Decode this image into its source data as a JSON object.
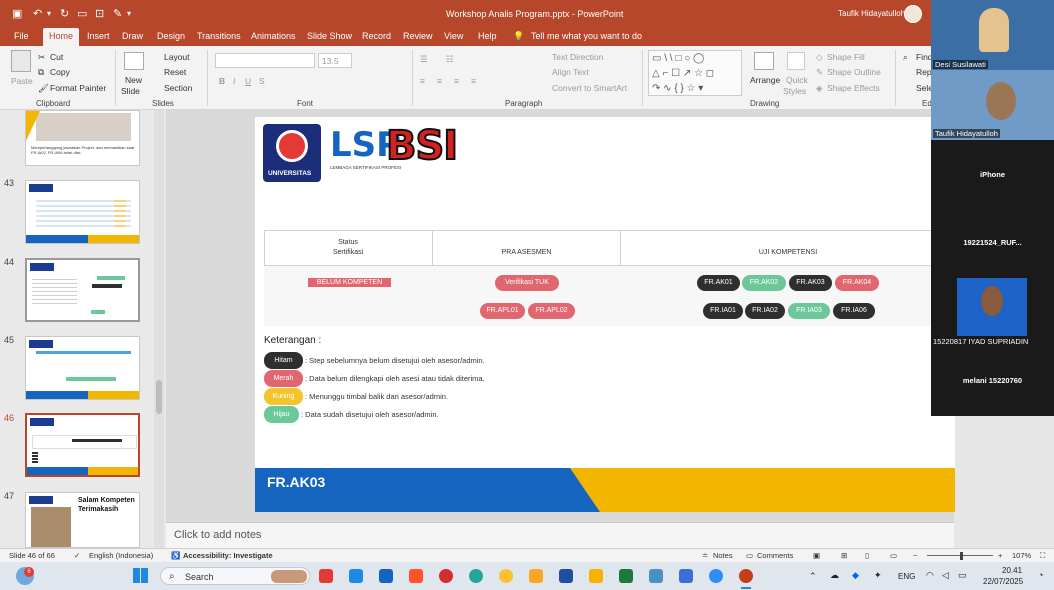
{
  "window": {
    "title": "Workshop Analis Program.pptx  -  PowerPoint",
    "user": "Taufik Hidayatulloh"
  },
  "menu": [
    "File",
    "Home",
    "Insert",
    "Draw",
    "Design",
    "Transitions",
    "Animations",
    "Slide Show",
    "Record",
    "Review",
    "View",
    "Help"
  ],
  "tell_me": "Tell me what you want to do",
  "ribbon": {
    "clipboard": {
      "paste": "Paste",
      "cut": "Cut",
      "copy": "Copy",
      "format_painter": "Format Painter",
      "group": "Clipboard"
    },
    "slides": {
      "new_slide": "New",
      "new_slide2": "Slide",
      "layout": "Layout",
      "reset": "Reset",
      "section": "Section",
      "group": "Slides"
    },
    "font": {
      "size": "13.5",
      "group": "Font"
    },
    "paragraph": {
      "text_direction": "Text Direction",
      "align_text": "Align Text",
      "smartart": "Convert to SmartArt",
      "group": "Paragraph"
    },
    "drawing": {
      "arrange": "Arrange",
      "quick": "Quick",
      "styles": "Styles",
      "shape_fill": "Shape Fill",
      "shape_outline": "Shape Outline",
      "shape_effects": "Shape Effects",
      "group": "Drawing"
    },
    "editing": {
      "find": "Find",
      "replace": "Rep",
      "select": "Sele",
      "group": "Ed"
    }
  },
  "thumbnails": {
    "numbers": [
      "43",
      "44",
      "45",
      "46",
      "47"
    ],
    "top_text": "Mempertanggung jawabkan Project, dan memastikan saat FR.IA02, FR.IA06 telah diisi.",
    "slide47_title": "Salam Kompeten",
    "slide47_sub": "Terimakasih"
  },
  "slide": {
    "logo": {
      "seal_text": "UNIVERSITAS",
      "lsp": "LSP",
      "bsi": "BSI",
      "sub": "LEMBAGA SERTIFIKASI PROFESI"
    },
    "table": {
      "col1a": "Status",
      "col1b": "Sertifikasi",
      "col2": "PRA ASESMEN",
      "col3": "UJI KOMPETENSI"
    },
    "status": "BELUM KOMPETEN",
    "pra": [
      "Verifikasi TUK",
      "FR.APL01",
      "FR.APL02"
    ],
    "uji_row1": [
      "FR.AK01",
      "FR.AK02",
      "FR.AK03",
      "FR.AK04"
    ],
    "uji_row2": [
      "FR.IA01",
      "FR.IA02",
      "FR.IA03",
      "FR.IA06"
    ],
    "keterangan": "Keterangan :",
    "legend": [
      {
        "label": "Hitam",
        "desc": ": Step sebelumnya belum disetujui oleh asesor/admin."
      },
      {
        "label": "Merah",
        "desc": ": Data belum dilengkapi oleh asesi atau tidak diterima."
      },
      {
        "label": "Kuning",
        "desc": ": Menunggu timbal balik dari asesor/admin."
      },
      {
        "label": "Hijau",
        "desc": ": Data sudah disetujui oleh asesor/admin."
      }
    ],
    "footer": "FR.AK03"
  },
  "notes": "Click to add notes",
  "video": {
    "p1": "Desi Susilawati",
    "p2": "Taufik Hidayatulloh",
    "p3": "iPhone",
    "p4": "19221524_RUF...",
    "p5": "15220817 IYAD SUPRIADIN",
    "p6": "melani 15220760"
  },
  "status": {
    "slide": "Slide 46 of 66",
    "lang": "English (Indonesia)",
    "accessibility": "Accessibility: Investigate",
    "notes": "Notes",
    "comments": "Comments",
    "zoom": "107%"
  },
  "taskbar": {
    "search": "Search",
    "lang": "ENG",
    "time": "20.41",
    "date": "22/07/2025",
    "badge": "6"
  },
  "colors": {
    "accent": "#b7472a",
    "blue": "#1565c0",
    "yellow": "#f2b600"
  }
}
